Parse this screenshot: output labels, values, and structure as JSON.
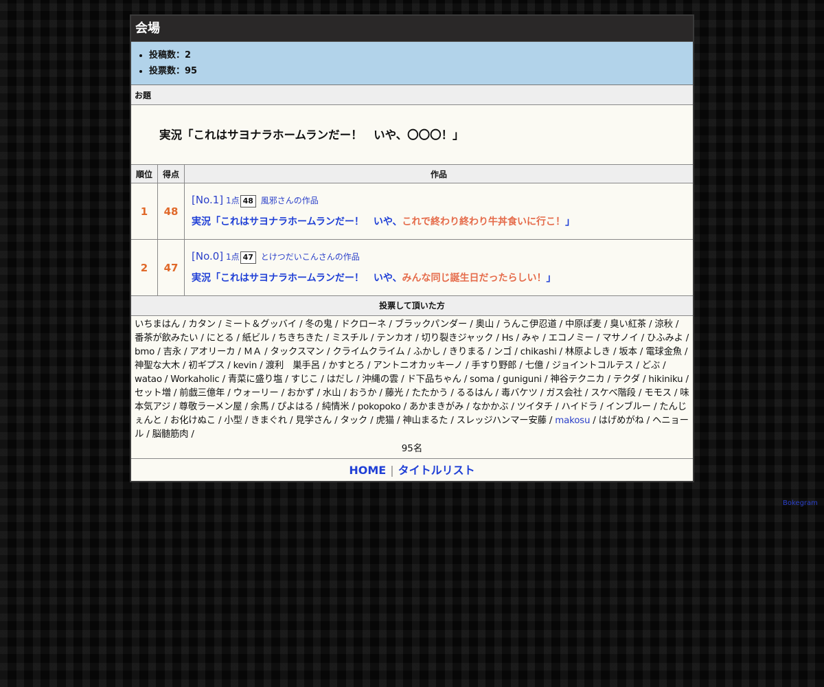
{
  "header": {
    "title": "会場"
  },
  "stats": {
    "posts": "投稿数：2",
    "votes": "投票数：95"
  },
  "theme": {
    "label": "お題",
    "text": "実況「これはサヨナラホームランだー！　いや、〇〇〇！」"
  },
  "table": {
    "headers": [
      "順位",
      "得点",
      "作品"
    ],
    "rows": [
      {
        "rank": "1",
        "score": "48",
        "no": "[No.1]",
        "point": "1点",
        "box": "48",
        "author": "風邪さんの作品",
        "prefix": "実況「これはサヨナラホームランだー！　いや、",
        "answer": "これで終わり終わり牛丼食いに行こ！",
        "suffix": "」"
      },
      {
        "rank": "2",
        "score": "47",
        "no": "[No.0]",
        "point": "1点",
        "box": "47",
        "author": "とけつだいこんさんの作品",
        "prefix": "実況「これはサヨナラホームランだー！　いや、",
        "answer": "みんな同じ誕生日だったらしい！",
        "suffix": "」"
      }
    ]
  },
  "voters": {
    "label": "投票して頂いた方",
    "text_before": "いちまはん / カタン / ミート＆グッバイ / 冬の鬼 / ドクローネ / ブラックパンダー / 奥山 / うんこ伊忍道 / 中原ぽ麦 / 臭い紅茶 / 涼秋 / 番茶が飲みたい / にとる / 紙ビル / ちきちきた / ミスチル / テンカオ / 切り裂きジャック / Hs / みゃ / エコノミー / マサノイ / ひふみよ / bmo / 吉永 / アオリーカ / ＭＡ / タックスマン / クライムクライム / ふかし / きりまる / ンゴ / chikashi / 林原よしき / 坂本 / 電球金魚 / 神聖な大木 / 初ギプス / kevin / 渡利　巣手呂 / かすとろ / アントニオカッキーノ / 手すり野郎 / 七億 / ジョイントコルテス / どぶ / watao / Workaholic / 青菜に盛り塩 / すじこ / はだし / 沖縄の雲 / ド下品ちゃん / soma / guniguni / 神谷テクニカ / テクダ / hikiniku / セット増 / 前戯三億年 / ウォーリー / おかず / 水山 / おうか / 藤光 / たたかう / るるはん / 毒バケツ / ガス会社 / スケベ階段 / モモス / 味本気アジ / 尊敬ラーメン屋 / 余馬 / ぴよはる / 純情米 / pokopoko / あかまきがみ / なかかぶ / ツイタチ / ハイドラ / インブルー / たんじぇんと / お化けぬこ / 小型 / きまぐれ / 見学さん / タック / 虎猫 / 神山まるた / スレッジハンマー安藤 / ",
    "link_name": "makosu",
    "text_after": " / はげめがね / ヘニョール / 脳髄筋肉 /",
    "count": "95名"
  },
  "footer": {
    "home": "HOME",
    "separator": "|",
    "titles": "タイトルリスト"
  },
  "credit": "Bokegram",
  "colors": {
    "accent_orange": "#e0692a",
    "link_blue": "#2a3fc9",
    "stats_bg": "#b2d3ea"
  }
}
